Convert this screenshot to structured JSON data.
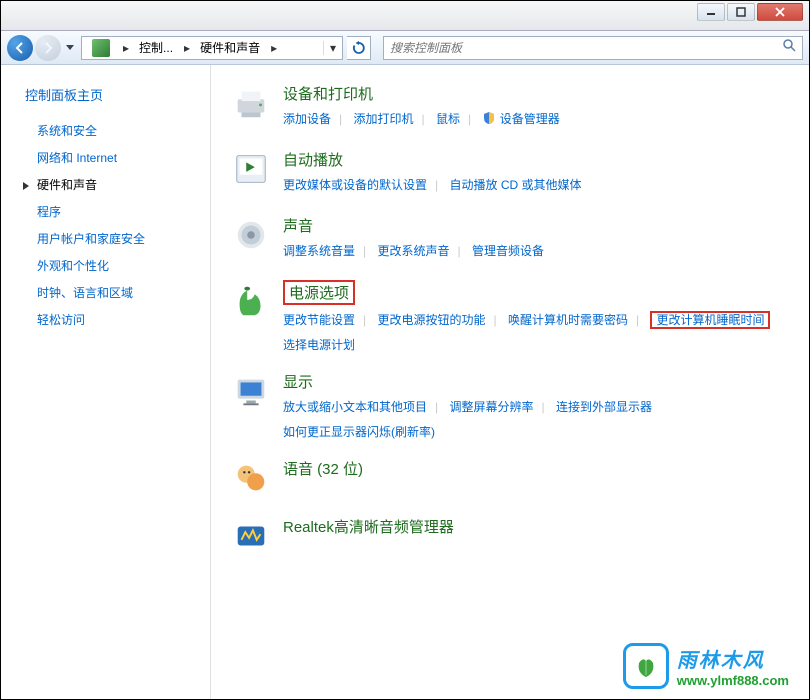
{
  "titlebar": {
    "min": "",
    "max": "",
    "close": ""
  },
  "nav": {
    "crumb1": "控制...",
    "crumb2": "硬件和声音",
    "search_placeholder": "搜索控制面板"
  },
  "sidebar": {
    "home": "控制面板主页",
    "items": [
      {
        "label": "系统和安全"
      },
      {
        "label": "网络和 Internet"
      },
      {
        "label": "硬件和声音"
      },
      {
        "label": "程序"
      },
      {
        "label": "用户帐户和家庭安全"
      },
      {
        "label": "外观和个性化"
      },
      {
        "label": "时钟、语言和区域"
      },
      {
        "label": "轻松访问"
      }
    ]
  },
  "categories": {
    "devices": {
      "title": "设备和打印机",
      "links": [
        "添加设备",
        "添加打印机",
        "鼠标",
        "设备管理器"
      ]
    },
    "autoplay": {
      "title": "自动播放",
      "links": [
        "更改媒体或设备的默认设置",
        "自动播放 CD 或其他媒体"
      ]
    },
    "sound": {
      "title": "声音",
      "links": [
        "调整系统音量",
        "更改系统声音",
        "管理音频设备"
      ]
    },
    "power": {
      "title": "电源选项",
      "links": [
        "更改节能设置",
        "更改电源按钮的功能",
        "唤醒计算机时需要密码",
        "更改计算机睡眠时间"
      ],
      "extra": "选择电源计划"
    },
    "display": {
      "title": "显示",
      "links": [
        "放大或缩小文本和其他项目",
        "调整屏幕分辨率",
        "连接到外部显示器"
      ],
      "extra": "如何更正显示器闪烁(刷新率)"
    },
    "speech": {
      "title": "语音 (32 位)"
    },
    "realtek": {
      "title": "Realtek高清晰音频管理器"
    }
  },
  "watermark": {
    "cn": "雨林木风",
    "url": "www.ylmf888.com"
  }
}
